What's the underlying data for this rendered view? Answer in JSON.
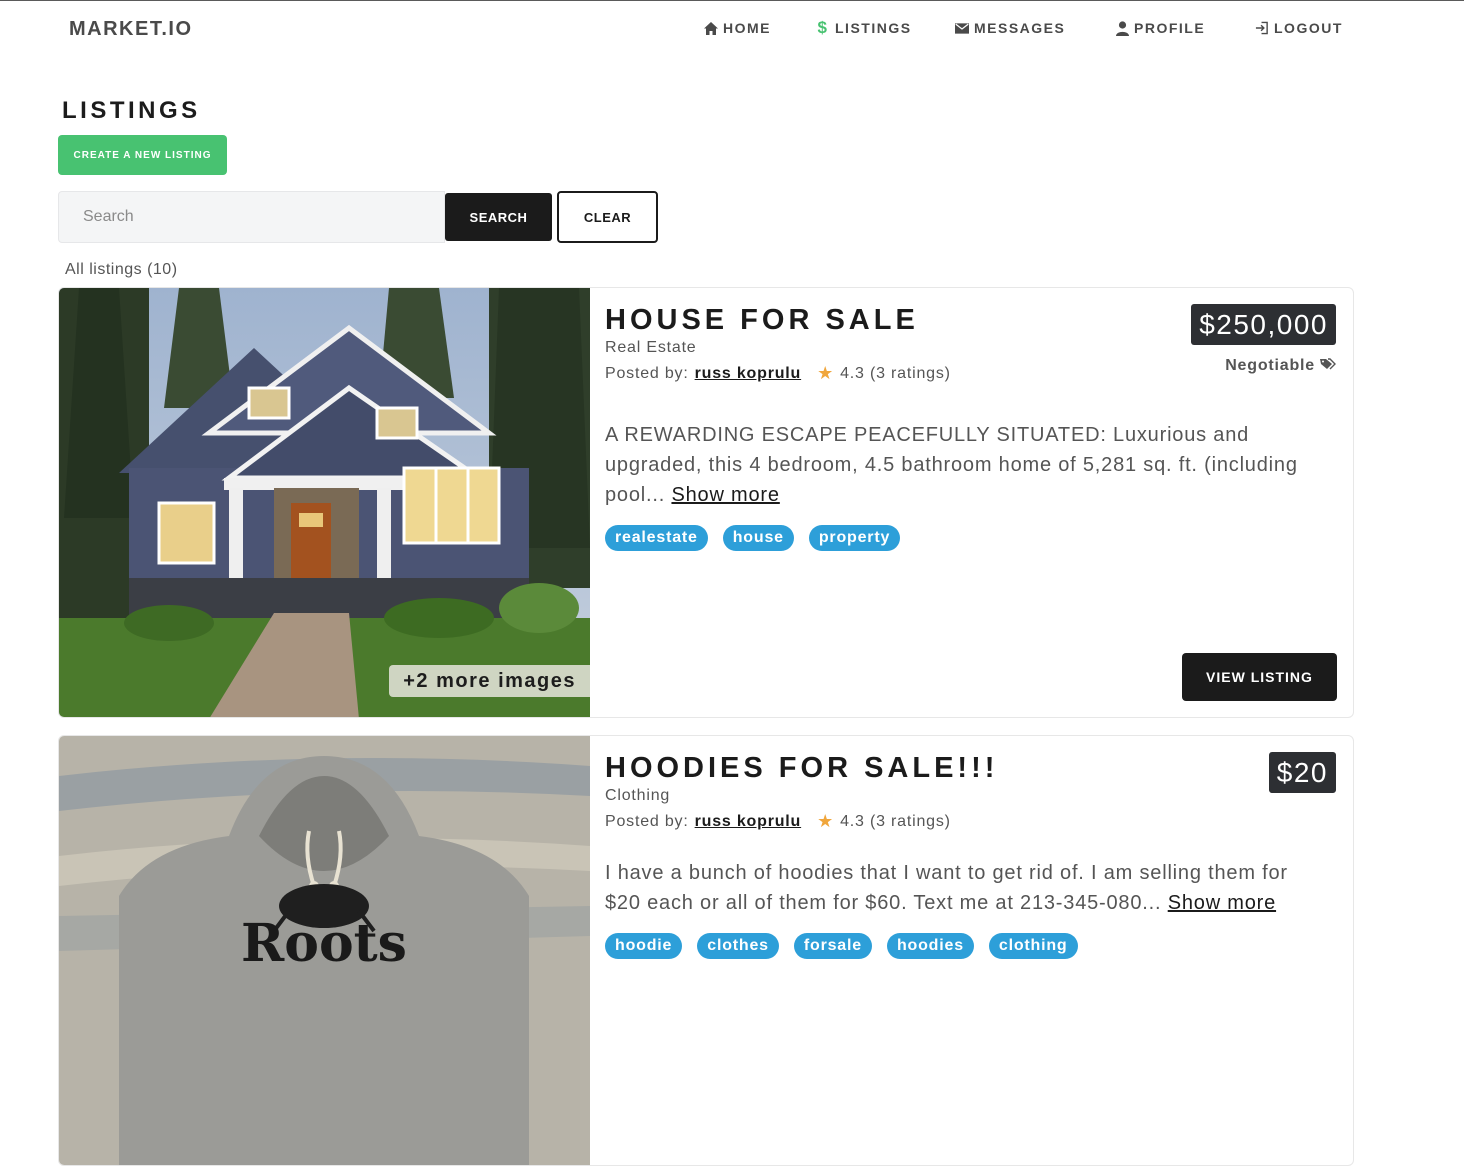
{
  "nav": {
    "brand": "MARKET.IO",
    "items": [
      {
        "label": "HOME",
        "icon": "home-icon"
      },
      {
        "label": "LISTINGS",
        "icon": "dollar-icon"
      },
      {
        "label": "MESSAGES",
        "icon": "envelope-icon"
      },
      {
        "label": "PROFILE",
        "icon": "user-icon"
      },
      {
        "label": "LOGOUT",
        "icon": "logout-icon"
      }
    ],
    "listings_icon_color": "#48c271"
  },
  "page": {
    "title": "LISTINGS",
    "create_button": "CREATE A NEW LISTING"
  },
  "search": {
    "placeholder": "Search",
    "value": "",
    "search_button": "SEARCH",
    "clear_button": "CLEAR"
  },
  "listings_count": "All listings (10)",
  "listings": [
    {
      "title": "HOUSE FOR SALE",
      "category": "Real Estate",
      "posted_by_label": "Posted by:",
      "seller": "russ koprulu",
      "rating": "4.3 (3 ratings)",
      "price": "$250,000",
      "negotiable": "Negotiable",
      "description": "A REWARDING ESCAPE PEACEFULLY SITUATED: Luxurious and upgraded, this 4 bedroom, 4.5 bathroom home of 5,281 sq. ft. (including pool...",
      "show_more": "Show more",
      "tags": [
        "realestate",
        "house",
        "property"
      ],
      "more_images": "+2 more images",
      "view_button": "VIEW LISTING",
      "image": "house-photo"
    },
    {
      "title": "HOODIES FOR SALE!!!",
      "category": "Clothing",
      "posted_by_label": "Posted by:",
      "seller": "russ koprulu",
      "rating": "4.3 (3 ratings)",
      "price": "$20",
      "description": "I have a bunch of hoodies that I want to get rid of. I am selling them for $20 each or all of them for $60. Text me at 213-345-080...",
      "show_more": "Show more",
      "tags": [
        "hoodie",
        "clothes",
        "forsale",
        "hoodies",
        "clothing"
      ],
      "image": "hoodie-photo",
      "image_text": "Roots"
    }
  ],
  "colors": {
    "accent_green": "#48c271",
    "tag_blue": "#2d9fd9",
    "dark": "#1b1b1b",
    "price_bg": "#2d2f33",
    "star": "#f0a63c"
  }
}
